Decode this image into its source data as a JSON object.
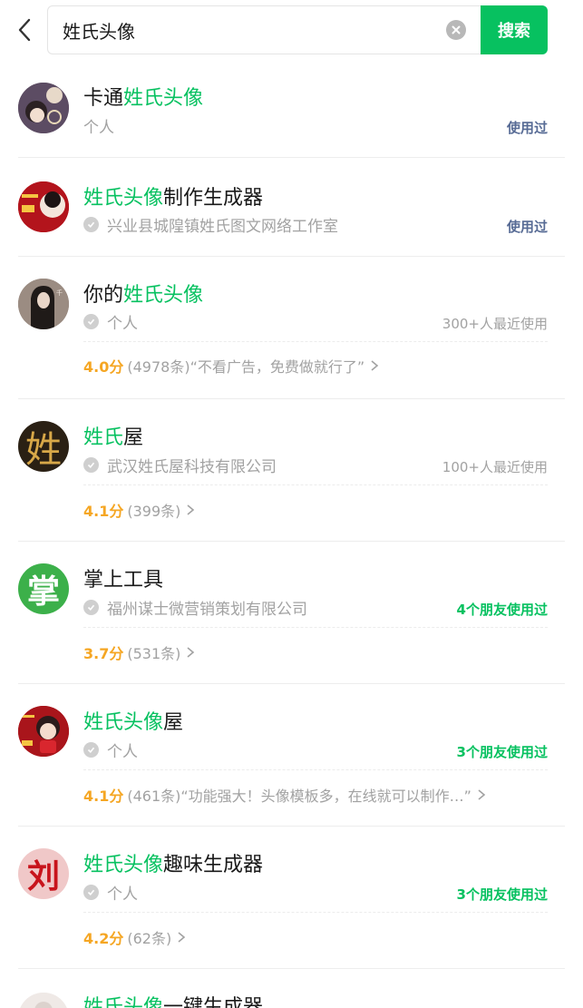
{
  "search": {
    "query": "姓氏头像",
    "button_label": "搜索"
  },
  "colors": {
    "accent": "#07c160",
    "blue_text": "#576b95",
    "rating": "#f5a623"
  },
  "results": [
    {
      "title_parts": [
        "卡通",
        "姓氏头像",
        ""
      ],
      "owner": "个人",
      "verified": false,
      "usage": "使用过",
      "usage_style": "blue",
      "avatar_icon": "cartoon-girl-avatar"
    },
    {
      "title_parts": [
        "",
        "姓氏头像",
        "制作生成器"
      ],
      "owner": "兴业县城隍镇姓氏图文网络工作室",
      "verified": true,
      "usage": "使用过",
      "usage_style": "blue",
      "avatar_icon": "red-new-year-avatar"
    },
    {
      "title_parts": [
        "你的",
        "姓氏头像",
        ""
      ],
      "owner": "个人",
      "verified": true,
      "usage": "300+人最近使用",
      "usage_style": "gray",
      "score": "4.0分",
      "reviews": "(4978条)",
      "quote": "“不看广告，免费做就行了”",
      "avatar_icon": "long-hair-girl-avatar"
    },
    {
      "title_parts": [
        "",
        "姓氏",
        "屋"
      ],
      "owner": "武汉姓氏屋科技有限公司",
      "verified": true,
      "usage": "100+人最近使用",
      "usage_style": "gray",
      "score": "4.1分",
      "reviews": "(399条)",
      "quote": "",
      "avatar_char": "姓",
      "avatar_icon": "gold-character-avatar"
    },
    {
      "title_parts": [
        "掌上工具",
        "",
        ""
      ],
      "owner": "福州谋士微营销策划有限公司",
      "verified": true,
      "usage": "4个朋友使用过",
      "usage_style": "green",
      "score": "3.7分",
      "reviews": "(531条)",
      "quote": "",
      "avatar_char": "掌",
      "avatar_icon": "green-character-avatar"
    },
    {
      "title_parts": [
        "",
        "姓氏头像",
        "屋"
      ],
      "owner": "个人",
      "verified": true,
      "usage": "3个朋友使用过",
      "usage_style": "green",
      "score": "4.1分",
      "reviews": "(461条)",
      "quote": "“功能强大！头像模板多，在线就可以制作…”",
      "avatar_icon": "red-cartoon-kid-avatar"
    },
    {
      "title_parts": [
        "",
        "姓氏头像",
        "趣味生成器"
      ],
      "owner": "个人",
      "verified": true,
      "usage": "3个朋友使用过",
      "usage_style": "green",
      "score": "4.2分",
      "reviews": "(62条)",
      "quote": "",
      "avatar_char": "刘",
      "avatar_icon": "red-calligraphy-avatar"
    },
    {
      "title_parts": [
        "",
        "姓氏头像",
        "一键生成器"
      ],
      "avatar_icon": "white-flower-avatar"
    }
  ]
}
